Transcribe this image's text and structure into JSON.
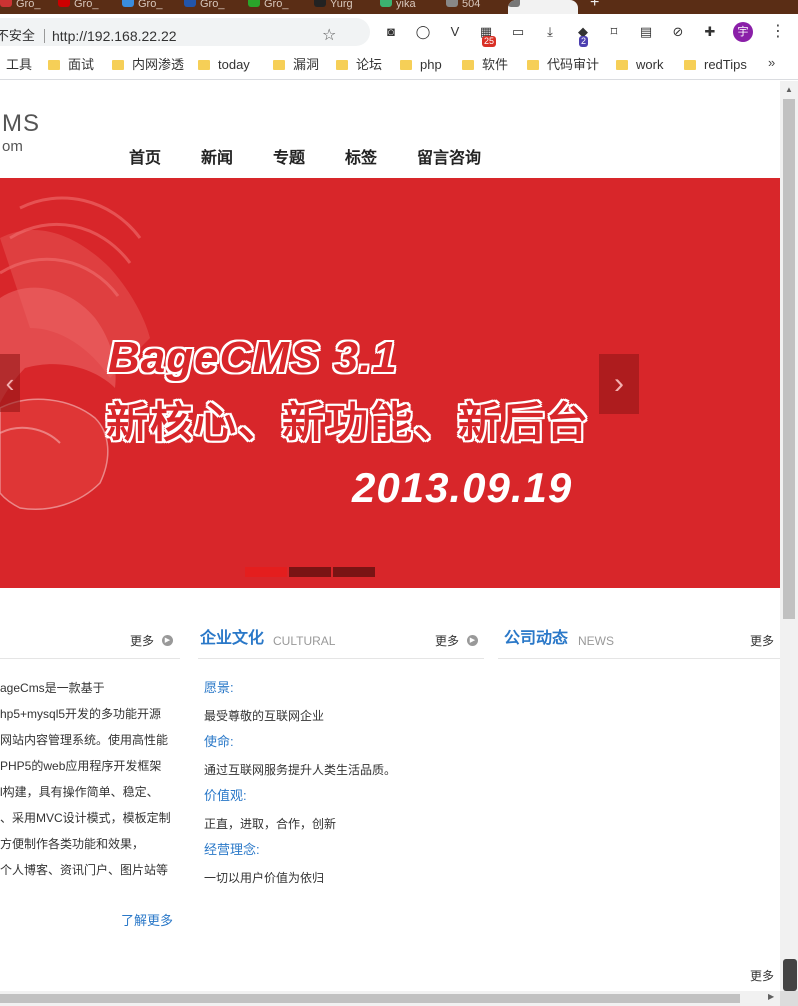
{
  "browser": {
    "tabs": [
      {
        "label": "Gro_",
        "fav": "#c33"
      },
      {
        "label": "Gro_",
        "fav": "#c00"
      },
      {
        "label": "Gro_",
        "fav": "#3a8dde"
      },
      {
        "label": "Gro_",
        "fav": "#2255aa"
      },
      {
        "label": "Gro_",
        "fav": "#2aa52a"
      },
      {
        "label": "Yurg",
        "fav": "#222"
      },
      {
        "label": "yika",
        "fav": "#3cb371"
      },
      {
        "label": "504",
        "fav": "#888"
      }
    ],
    "active_tab": "",
    "new_tab": "+",
    "address": {
      "security_label": "不安全",
      "url": "http://192.168.22.22",
      "star": "☆"
    },
    "extensions": [
      {
        "name": "tampermonkey-icon",
        "glyph": "◙"
      },
      {
        "name": "circle-icon",
        "glyph": "◯"
      },
      {
        "name": "vpn-icon",
        "glyph": "V"
      },
      {
        "name": "extension-badge-icon",
        "glyph": "▦",
        "badge": "25"
      },
      {
        "name": "window-icon",
        "glyph": "▭"
      },
      {
        "name": "download-icon",
        "glyph": "⤓"
      },
      {
        "name": "stack-icon",
        "glyph": "◆",
        "badge": "2"
      },
      {
        "name": "bookmark-icon",
        "glyph": "⌑"
      },
      {
        "name": "translate-icon",
        "glyph": "▤"
      },
      {
        "name": "link-icon",
        "glyph": "⊘"
      },
      {
        "name": "puzzle-icon",
        "glyph": "✚"
      }
    ],
    "profile": "宇",
    "menu": "⋮",
    "bookmarks": [
      {
        "label": "工具",
        "folder": false
      },
      {
        "label": "面试",
        "folder": true
      },
      {
        "label": "内网渗透",
        "folder": true
      },
      {
        "label": "today",
        "folder": true
      },
      {
        "label": "漏洞",
        "folder": true
      },
      {
        "label": "论坛",
        "folder": true
      },
      {
        "label": "php",
        "folder": true
      },
      {
        "label": "软件",
        "folder": true
      },
      {
        "label": "代码审计",
        "folder": true
      },
      {
        "label": "work",
        "folder": true
      },
      {
        "label": "redTips",
        "folder": true
      }
    ],
    "bookmarks_more": "»"
  },
  "site": {
    "logo_top": "MS",
    "logo_sub": "om",
    "nav": [
      "首页",
      "新闻",
      "专题",
      "标签",
      "留言咨询"
    ],
    "banner": {
      "title": "BageCMS 3.1",
      "subtitle": "新核心、新功能、新后台",
      "date": "2013.09.19",
      "prev": "‹",
      "next": "›",
      "dots": [
        "active",
        "inactive",
        "inactive"
      ],
      "colors": {
        "bg": "#d8262a",
        "dot_active": "#e41e1e",
        "dot_inactive": "#7a1414"
      }
    },
    "sections": {
      "about": {
        "more": "更多",
        "lines": [
          "ageCms是一款基于",
          "hp5+mysql5开发的多功能开源",
          "网站内容管理系统。使用高性能",
          "PHP5的web应用程序开发框架",
          "l构建，具有操作简单、稳定、",
          "、采用MVC设计模式，模板定制",
          "方便制作各类功能和效果，",
          "个人博客、资讯门户、图片站等"
        ],
        "learn_more": "了解更多"
      },
      "culture": {
        "title": "企业文化",
        "en": "CULTURAL",
        "more": "更多",
        "items": [
          {
            "k": "愿景:",
            "v": "最受尊敬的互联网企业"
          },
          {
            "k": "使命:",
            "v": "通过互联网服务提升人类生活品质。"
          },
          {
            "k": "价值观:",
            "v": "正直，进取，合作，创新"
          },
          {
            "k": "经营理念:",
            "v": "一切以用户价值为依归"
          }
        ]
      },
      "news": {
        "title": "公司动态",
        "en": "NEWS",
        "more": "更多"
      }
    },
    "bottom_more": "更多"
  }
}
